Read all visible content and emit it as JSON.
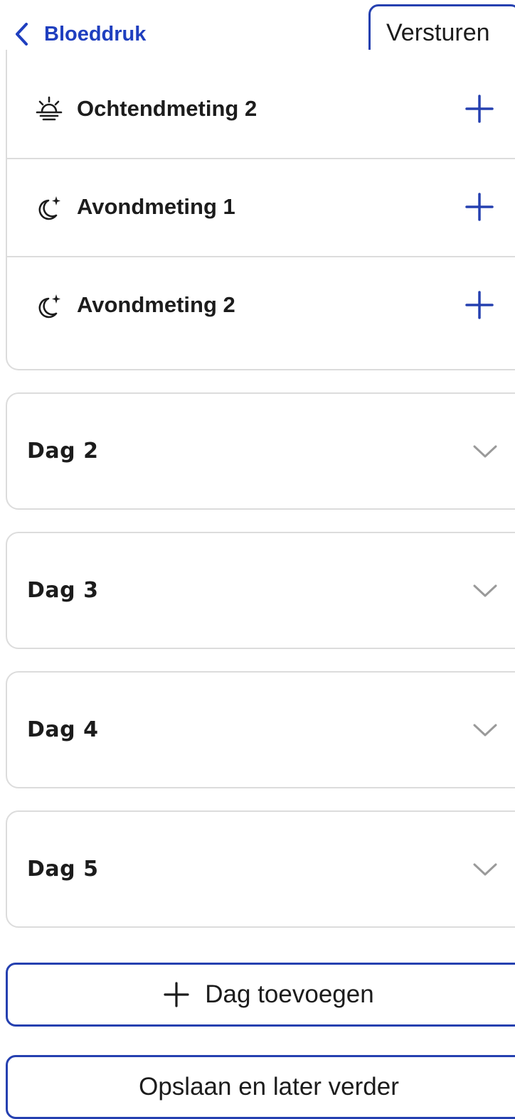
{
  "header": {
    "back_label": "Bloeddruk",
    "send_label": "Versturen"
  },
  "measurements": [
    {
      "label": "Ochtendmeting 2",
      "icon": "sunrise-icon"
    },
    {
      "label": "Avondmeting 1",
      "icon": "moon-stars-icon"
    },
    {
      "label": "Avondmeting 2",
      "icon": "moon-stars-icon"
    }
  ],
  "days": [
    {
      "label": "Dag 2"
    },
    {
      "label": "Dag 3"
    },
    {
      "label": "Dag 4"
    },
    {
      "label": "Dag 5"
    }
  ],
  "actions": {
    "add_day_label": "Dag toevoegen",
    "save_later_label": "Opslaan en later verder"
  },
  "colors": {
    "accent": "#2540b0",
    "text": "#1c1c1c",
    "border": "#dcdcdc",
    "chevron": "#9a9a9a"
  }
}
